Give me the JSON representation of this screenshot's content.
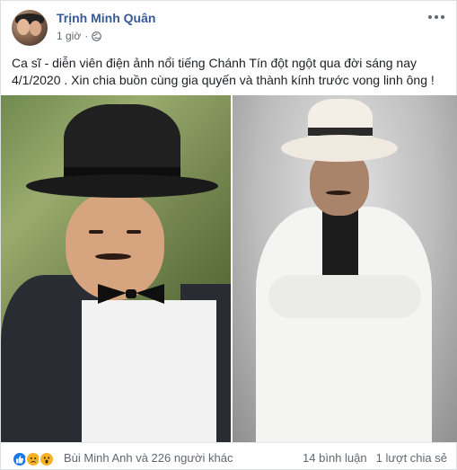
{
  "post": {
    "author": "Trịnh Minh Quân",
    "time": "1 giờ",
    "separator": "·",
    "text": "Ca sĩ - diễn viên điện ảnh nổi tiếng Chánh Tín đột ngột qua đời sáng nay 4/1/2020 . Xin chia buồn cùng gia quyến và thành kính trước vong linh ông !"
  },
  "icons": {
    "more": "more-options-icon",
    "privacy": "globe-icon",
    "reactions": [
      "like-icon",
      "sad-icon",
      "wow-icon"
    ]
  },
  "reactions": {
    "summary": "Bùi Minh Anh và 226 người khác"
  },
  "stats": {
    "comments": "14 bình luận",
    "shares": "1 lượt chia sẻ"
  },
  "colors": {
    "author": "#385898",
    "like": "#1877f2",
    "emoji": "#f7b125",
    "meta": "#606770"
  }
}
